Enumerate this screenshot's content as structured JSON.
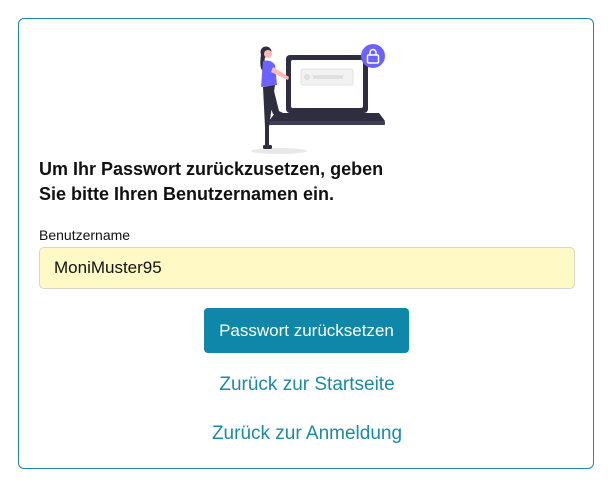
{
  "form": {
    "heading_line1": "Um Ihr Passwort zurückzusetzen, geben",
    "heading_line2": "Sie bitte Ihren Benutzernamen ein.",
    "username_label": "Benutzername",
    "username_value": "MoniMuster95",
    "submit_label": "Passwort zurücksetzen"
  },
  "links": {
    "home": "Zurück zur Startseite",
    "login": "Zurück zur Anmeldung"
  },
  "illustration": {
    "icon": "woman-with-laptop-and-lock-illustration",
    "accent_color": "#6c63ff"
  },
  "colors": {
    "primary": "#0e87a8",
    "link": "#1b8aa2",
    "input_background": "#fff9c6",
    "card_border": "#1b8aa2"
  }
}
